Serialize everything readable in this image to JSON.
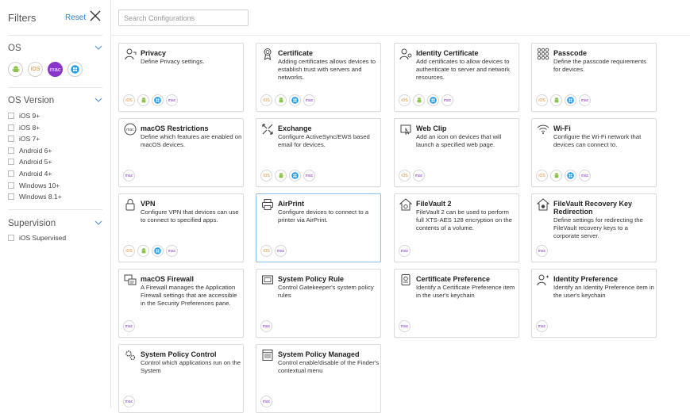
{
  "filters": {
    "title": "Filters",
    "reset_label": "Reset"
  },
  "os_section": {
    "title": "OS",
    "os_options": [
      {
        "name": "android",
        "label": "",
        "selected": false
      },
      {
        "name": "ios",
        "label": "iOS",
        "selected": false
      },
      {
        "name": "mac",
        "label": "mac",
        "selected": true
      },
      {
        "name": "windows",
        "label": "",
        "selected": false
      }
    ]
  },
  "os_version": {
    "title": "OS Version",
    "items": [
      "iOS 9+",
      "iOS 8+",
      "iOS 7+",
      "Android 6+",
      "Android 5+",
      "Android 4+",
      "Windows 10+",
      "Windows 8.1+"
    ]
  },
  "supervision": {
    "title": "Supervision",
    "items": [
      "iOS Supervised"
    ]
  },
  "search": {
    "placeholder": "Search Configurations",
    "value": ""
  },
  "colors": {
    "accent": "#2f7fd1",
    "mac": "#8a35c9",
    "ios": "#e38a2b",
    "android": "#8bc34a",
    "windows": "#1e9be9"
  },
  "badge_labels": {
    "ios": "iOS",
    "mac": "mac"
  },
  "cards": [
    {
      "title": "Privacy",
      "desc": "Define Privacy settings.",
      "icon": "privacy-icon",
      "platforms": [
        "ios",
        "android",
        "windows",
        "mac"
      ]
    },
    {
      "title": "Certificate",
      "desc": "Adding certificates allows devices to establish trust with servers and networks.",
      "icon": "certificate-icon",
      "platforms": [
        "ios",
        "android",
        "windows",
        "mac"
      ]
    },
    {
      "title": "Identity Certificate",
      "desc": "Add certificates to allow devices to authenticate to server and network resources.",
      "icon": "identity-certificate-icon",
      "platforms": [
        "ios",
        "android",
        "windows",
        "mac"
      ]
    },
    {
      "title": "Passcode",
      "desc": "Define the passcode requirements for devices.",
      "icon": "passcode-icon",
      "platforms": [
        "ios",
        "android",
        "windows",
        "mac"
      ]
    },
    {
      "title": "macOS Restrictions",
      "desc": "Define which features are enabled on macOS devices.",
      "icon": "restrictions-icon",
      "platforms": [
        "mac"
      ]
    },
    {
      "title": "Exchange",
      "desc": "Configure ActiveSync/EWS based email for devices.",
      "icon": "exchange-icon",
      "platforms": [
        "ios",
        "android",
        "windows",
        "mac"
      ]
    },
    {
      "title": "Web Clip",
      "desc": "Add an icon on devices that will launch a specified web page.",
      "icon": "web-clip-icon",
      "platforms": [
        "ios",
        "mac"
      ]
    },
    {
      "title": "Wi-Fi",
      "desc": "Configure the Wi-Fi network that devices can connect to.",
      "icon": "wifi-icon",
      "platforms": [
        "ios",
        "android",
        "windows",
        "mac"
      ]
    },
    {
      "title": "VPN",
      "desc": "Configure VPN that devices can use to connect to specified apps.",
      "icon": "vpn-icon",
      "platforms": [
        "ios",
        "android",
        "windows",
        "mac"
      ]
    },
    {
      "title": "AirPrint",
      "desc": "Configure devices to connect to a printer via AirPrint.",
      "icon": "printer-icon",
      "platforms": [
        "ios",
        "mac"
      ],
      "selected": true
    },
    {
      "title": "FileVault 2",
      "desc": "FileVault 2 can be used to perform full XTS-AES 128 encryption on the contents of a volume.",
      "icon": "filevault-icon",
      "platforms": [
        "mac"
      ]
    },
    {
      "title": "FileVault Recovery Key Redirection",
      "desc": "Define settings for redirecting the FileVault recovery keys to a corporate server.",
      "icon": "filevault-recovery-icon",
      "platforms": [
        "mac"
      ]
    },
    {
      "title": "macOS Firewall",
      "desc": "A Firewall manages the Application Firewall settings that are accessible in the Security Preferences pane.",
      "icon": "firewall-icon",
      "platforms": [
        "mac"
      ]
    },
    {
      "title": "System Policy Rule",
      "desc": "Control Gatekeeper's system policy rules",
      "icon": "policy-rule-icon",
      "platforms": [
        "mac"
      ]
    },
    {
      "title": "Certificate Preference",
      "desc": "Identify a Certificate Preference item in the user's keychain",
      "icon": "certificate-preference-icon",
      "platforms": [
        "mac"
      ]
    },
    {
      "title": "Identity Preference",
      "desc": "Identify an Identity Preference item in the user's keychain",
      "icon": "identity-preference-icon",
      "platforms": [
        "mac"
      ]
    },
    {
      "title": "System Policy Control",
      "desc": "Control which applications run on the System",
      "icon": "policy-control-icon",
      "platforms": [
        "mac"
      ]
    },
    {
      "title": "System Policy Managed",
      "desc": "Control enable/disable of the Finder's contextual menu",
      "icon": "policy-managed-icon",
      "platforms": [
        "mac"
      ]
    }
  ]
}
